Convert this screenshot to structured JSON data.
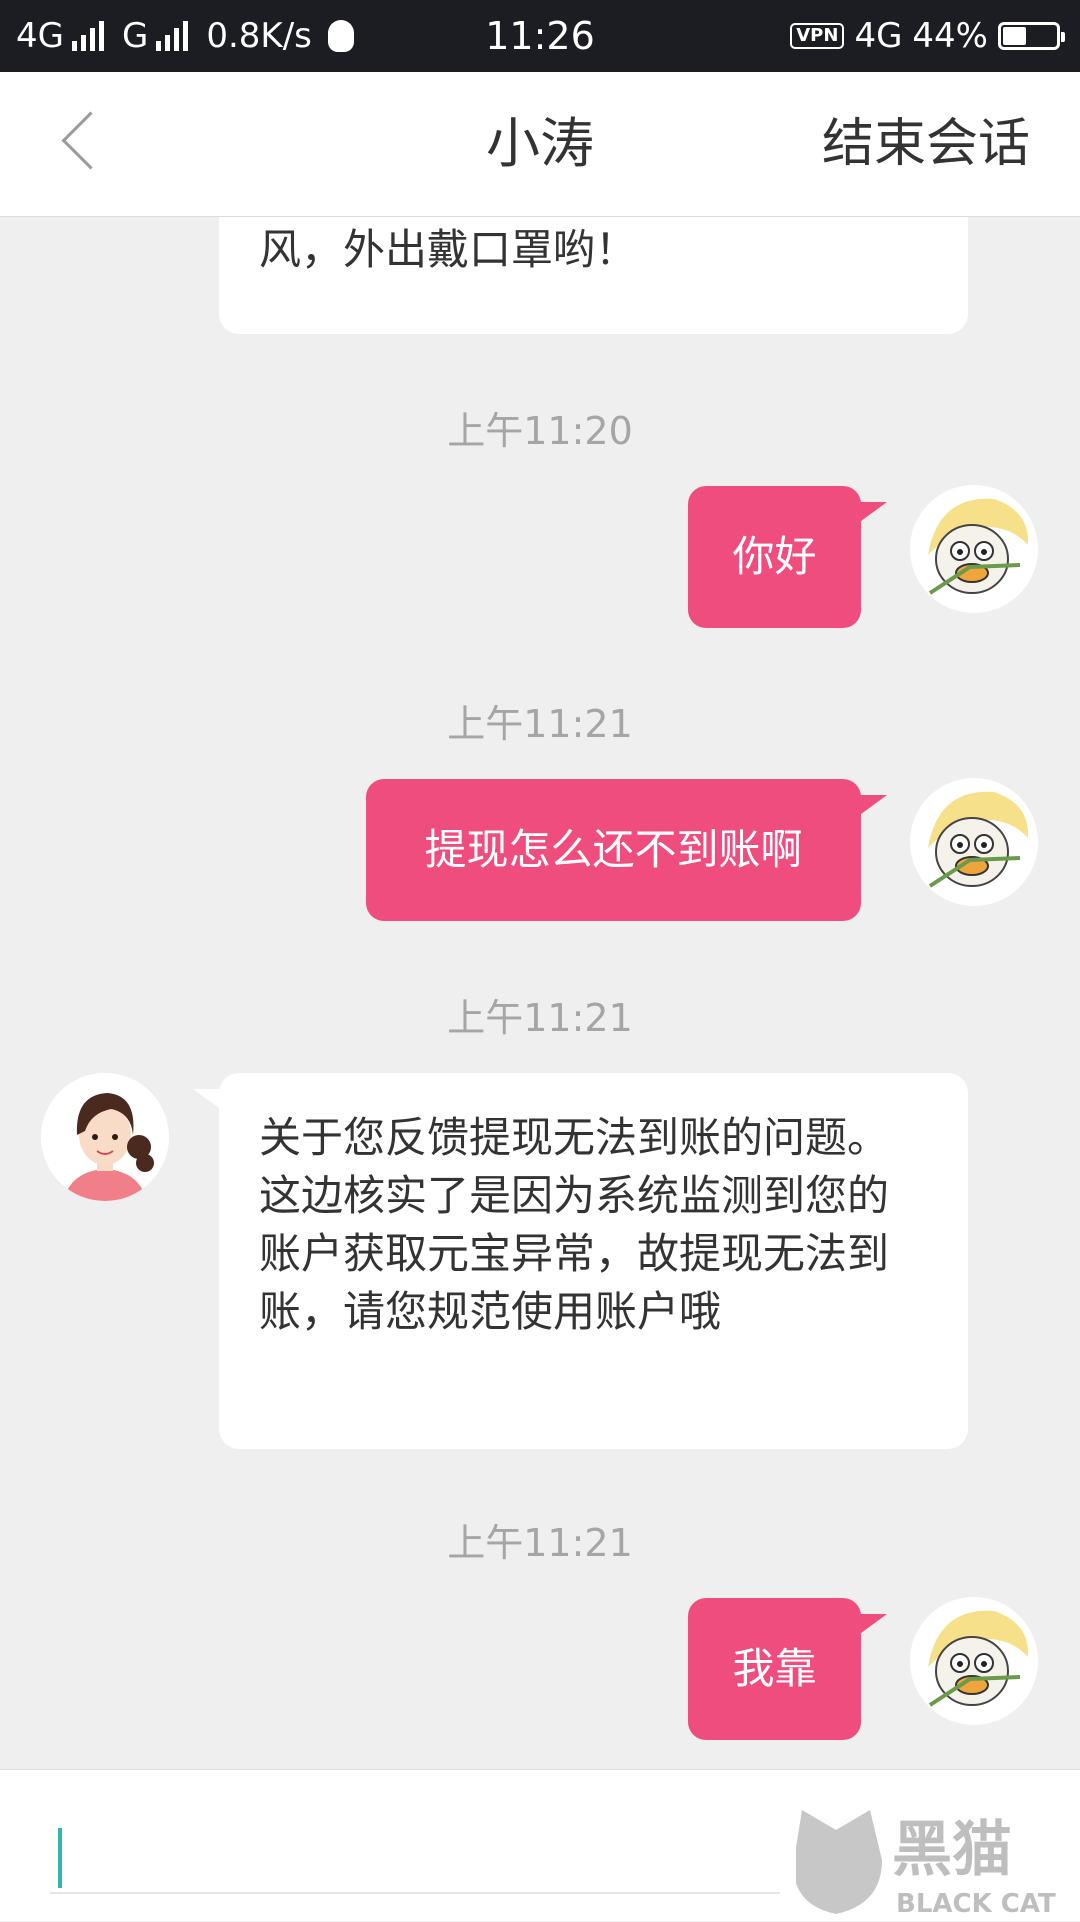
{
  "status_bar": {
    "net1": "4G",
    "net2": "G",
    "speed": "0.8K/s",
    "time": "11:26",
    "vpn": "VPN",
    "net3": "4G",
    "battery_text": "44%",
    "battery_level": 0.44
  },
  "header": {
    "title": "小涛",
    "end_session": "结束会话"
  },
  "messages": {
    "partial_text": "风，外出戴口罩哟！",
    "ts1": "上午11:20",
    "msg1": "你好",
    "ts2": "上午11:21",
    "msg2": "提现怎么还不到账啊",
    "ts3": "上午11:21",
    "reply": "关于您反馈提现无法到账的问题。这边核实了是因为系统监测到您的账户获取元宝异常，故提现无法到账，请您规范使用账户哦",
    "ts4": "上午11:21",
    "msg3": "我靠"
  },
  "watermark": {
    "cn": "黑猫",
    "en": "BLACK CAT"
  },
  "colors": {
    "accent": "#f04d7f",
    "status_bar_bg": "#1c1d22",
    "chat_bg": "#efeff0",
    "caret": "#33b5a8"
  },
  "icons": [
    "back-chevron-icon",
    "qq-icon",
    "battery-icon",
    "duck-avatar",
    "girl-avatar"
  ]
}
